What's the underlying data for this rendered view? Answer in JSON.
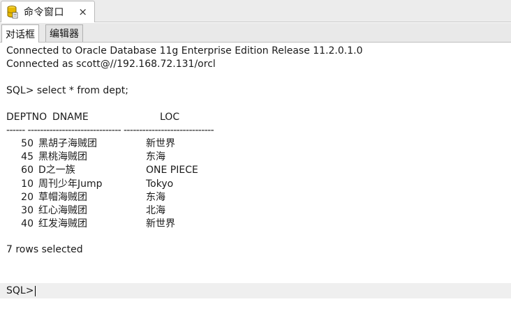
{
  "window_tab": {
    "title": "命令窗口",
    "close": "×"
  },
  "subtabs": [
    {
      "label": "对话框",
      "active": true
    },
    {
      "label": "编辑器",
      "active": false
    }
  ],
  "console": {
    "connect_line_1": "Connected to Oracle Database 11g Enterprise Edition Release 11.2.0.1.0",
    "connect_line_2": "Connected as scott@//192.168.72.131/orcl",
    "query": "SQL> select * from dept;",
    "header": {
      "deptno": "DEPTNO",
      "dname": "DNAME",
      "loc": "LOC"
    },
    "separator": "------ ------------------------------ -----------------------------",
    "rows": [
      {
        "deptno": "50",
        "dname": "黑胡子海贼团",
        "loc": "新世界"
      },
      {
        "deptno": "45",
        "dname": "黑桃海贼团",
        "loc": "东海"
      },
      {
        "deptno": "60",
        "dname": "D之一族",
        "loc": "ONE PIECE"
      },
      {
        "deptno": "10",
        "dname": "周刊少年Jump",
        "loc": "Tokyo"
      },
      {
        "deptno": "20",
        "dname": "草帽海贼团",
        "loc": "东海"
      },
      {
        "deptno": "30",
        "dname": "红心海贼团",
        "loc": "北海"
      },
      {
        "deptno": "40",
        "dname": "红发海贼团",
        "loc": "新世界"
      }
    ],
    "rows_selected": "7 rows selected",
    "prompt": "SQL>"
  },
  "colors": {
    "tab_bg": "#ececec",
    "active_tab": "#ffffff",
    "prompt_bar": "#efefef",
    "icon": "#e6b800"
  },
  "icons": {
    "tab_icon": "database-cylinder-icon"
  }
}
